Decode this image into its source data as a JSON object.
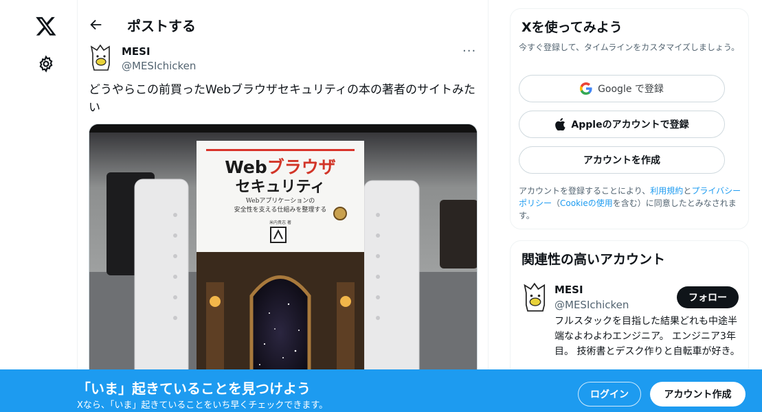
{
  "nav": {
    "logo_icon": "x-logo-icon",
    "settings_icon": "gear-icon"
  },
  "header": {
    "title": "ポストする",
    "back_icon": "arrow-left-icon"
  },
  "post": {
    "author_name": "MESI",
    "author_handle": "@MESIchicken",
    "more_label": "···",
    "text": "どうやらこの前買ったWebブラウザセキュリティの本の著者のサイトみたい",
    "image": {
      "book_title_prefix": "Web",
      "book_title_main": "ブラウザ",
      "book_title_line2": "セキュリティ",
      "book_subtitle_1": "Webアプリケーションの",
      "book_subtitle_2": "安全性を支える仕組みを整理する",
      "book_author": "米内貴志 著"
    }
  },
  "signup_card": {
    "title": "Xを使ってみよう",
    "subtitle": "今すぐ登録して、タイムラインをカスタマイズしましょう。",
    "google_button": "Google で登録",
    "apple_button": "Appleのアカウントで登録",
    "create_button": "アカウントを作成",
    "legal_1": "アカウントを登録することにより、",
    "legal_terms": "利用規約",
    "legal_and": "と",
    "legal_privacy": "プライバシーポリシー",
    "legal_open": "（",
    "legal_cookie": "Cookieの使用",
    "legal_2": "を含む）に同意したとみなされます。"
  },
  "related": {
    "title": "関連性の高いアカウント",
    "name": "MESI",
    "handle": "@MESIchicken",
    "follow_label": "フォロー",
    "bio": "フルスタックを目指した結果どれも中途半端なよわよわエンジニア。 エンジニア3年目。 技術書とデスク作りと自転車が好き。"
  },
  "banner": {
    "title": "「いま」起きていることを見つけよう",
    "subtitle": "Xなら、「いま」起きていることをいち早くチェックできます。",
    "login_label": "ログイン",
    "signup_label": "アカウント作成"
  },
  "colors": {
    "accent": "#1d9bf0",
    "text": "#0f1419",
    "muted": "#536471"
  }
}
